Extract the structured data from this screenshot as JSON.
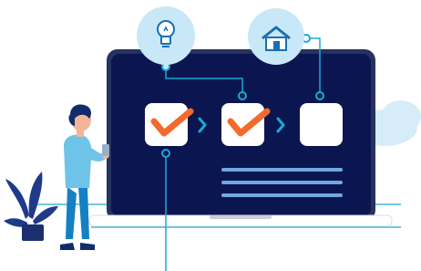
{
  "illustration": {
    "steps": [
      {
        "state": "done",
        "icon": "checkmark-icon"
      },
      {
        "state": "done",
        "icon": "checkmark-icon"
      },
      {
        "state": "pending",
        "icon": ""
      }
    ],
    "connectors": [
      "chevron-right-icon",
      "chevron-right-icon"
    ],
    "top_icons": [
      "lightbulb-icon",
      "house-icon"
    ],
    "content_lines": 3
  },
  "colors": {
    "screen": "#0b1650",
    "laptop_frame": "#26325f",
    "laptop_base": "#ffffff",
    "accent_orange": "#f26a2e",
    "accent_cyan": "#19a9d5",
    "bubble": "#c9e8f7",
    "icon_blue": "#1a6fb3",
    "cloud": "#d6edf9",
    "plant": "#1f3a8a",
    "person_skin": "#f2b59a",
    "person_hair": "#132b6b",
    "person_shirt": "#6ec3e8",
    "person_pants": "#1580c2"
  }
}
